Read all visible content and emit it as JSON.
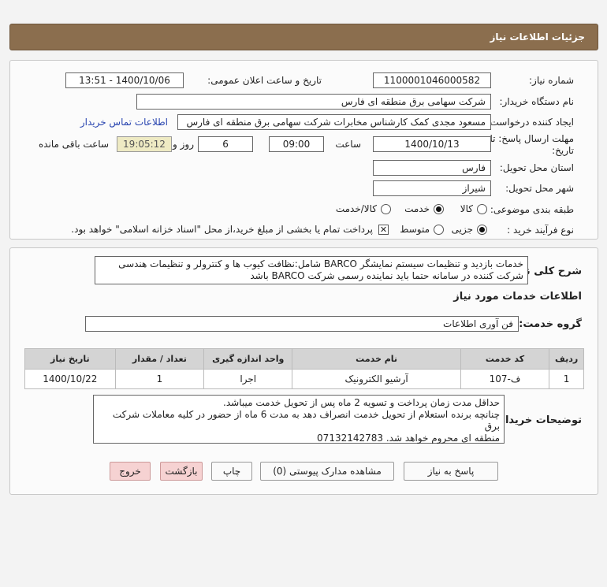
{
  "header": {
    "title": "جزئیات اطلاعات نیاز"
  },
  "info": {
    "need_number_label": "شماره نیاز:",
    "need_number": "1100001046000582",
    "announce_label": "تاریخ و ساعت اعلان عمومی:",
    "announce_value": "1400/10/06 - 13:51",
    "buyer_org_label": "نام دستگاه خریدار:",
    "buyer_org": "شرکت سهامی برق منطقه ای فارس",
    "creator_label": "ایجاد کننده درخواست:",
    "creator": "مسعود مجدی کمک کارشناس مخابرات شرکت سهامی برق منطقه ای فارس",
    "contact_link": "اطلاعات تماس خریدار",
    "deadline_label_1": "مهلت ارسال پاسخ: تا",
    "deadline_label_2": "تاریخ:",
    "deadline_date": "1400/10/13",
    "time_label": "ساعت",
    "deadline_time": "09:00",
    "days": "6",
    "days_label": "روز و",
    "remaining_time": "19:05:12",
    "remaining_label": "ساعت باقی مانده",
    "province_label": "استان محل تحویل:",
    "province": "فارس",
    "city_label": "شهر محل تحویل:",
    "city": "شیراز",
    "category_label": "طبقه بندی موضوعی:",
    "category_options": [
      "کالا",
      "خدمت",
      "کالا/خدمت"
    ],
    "process_label": "نوع فرآیند خرید :",
    "process_options": [
      "جزیی",
      "متوسط"
    ],
    "payment_note": "پرداخت تمام یا بخشی از مبلغ خرید،از محل \"اسناد خزانه اسلامی\" خواهد بود."
  },
  "details": {
    "summary_label": "شرح کلی نیاز:",
    "summary_text": "خدمات بازدید و تنظیمات سیستم نمایشگر BARCO شامل:نظافت کیوب ها و کنترولر و تنظیمات هندسی شرکت کننده در سامانه حتما باید نماینده رسمی شرکت BARCO باشد",
    "services_title": "اطلاعات خدمات مورد نیاز",
    "service_group_label": "گروه خدمت:",
    "service_group": "فن آوری اطلاعات",
    "table": {
      "headers": [
        "ردیف",
        "کد خدمت",
        "نام خدمت",
        "واحد اندازه گیری",
        "تعداد / مقدار",
        "تاریخ نیاز"
      ],
      "rows": [
        [
          "1",
          "ف-107",
          "آرشیو الکترونیک",
          "اجرا",
          "1",
          "1400/10/22"
        ]
      ]
    },
    "buyer_notes_label": "توضیحات خریدار:",
    "buyer_notes_lines": [
      "حداقل مدت زمان پرداخت و تسویه 2 ماه پس از تحویل خدمت میباشد.",
      "چنانچه برنده استعلام از تحویل خدمت انصراف دهد به مدت 6 ماه از حضور در کلیه معاملات شرکت برق",
      "منطقه ای محروم خواهد شد. 07132142783"
    ]
  },
  "buttons": {
    "reply": "پاسخ به نیاز",
    "attachments": "مشاهده مدارک پیوستی (0)",
    "print": "چاپ",
    "back": "بازگشت",
    "exit": "خروج"
  },
  "colors": {
    "header": "#8b6e4e",
    "remaining_bg": "#eeeac3",
    "link": "#2a46b0",
    "exit_btn": "#f6d2d2"
  }
}
